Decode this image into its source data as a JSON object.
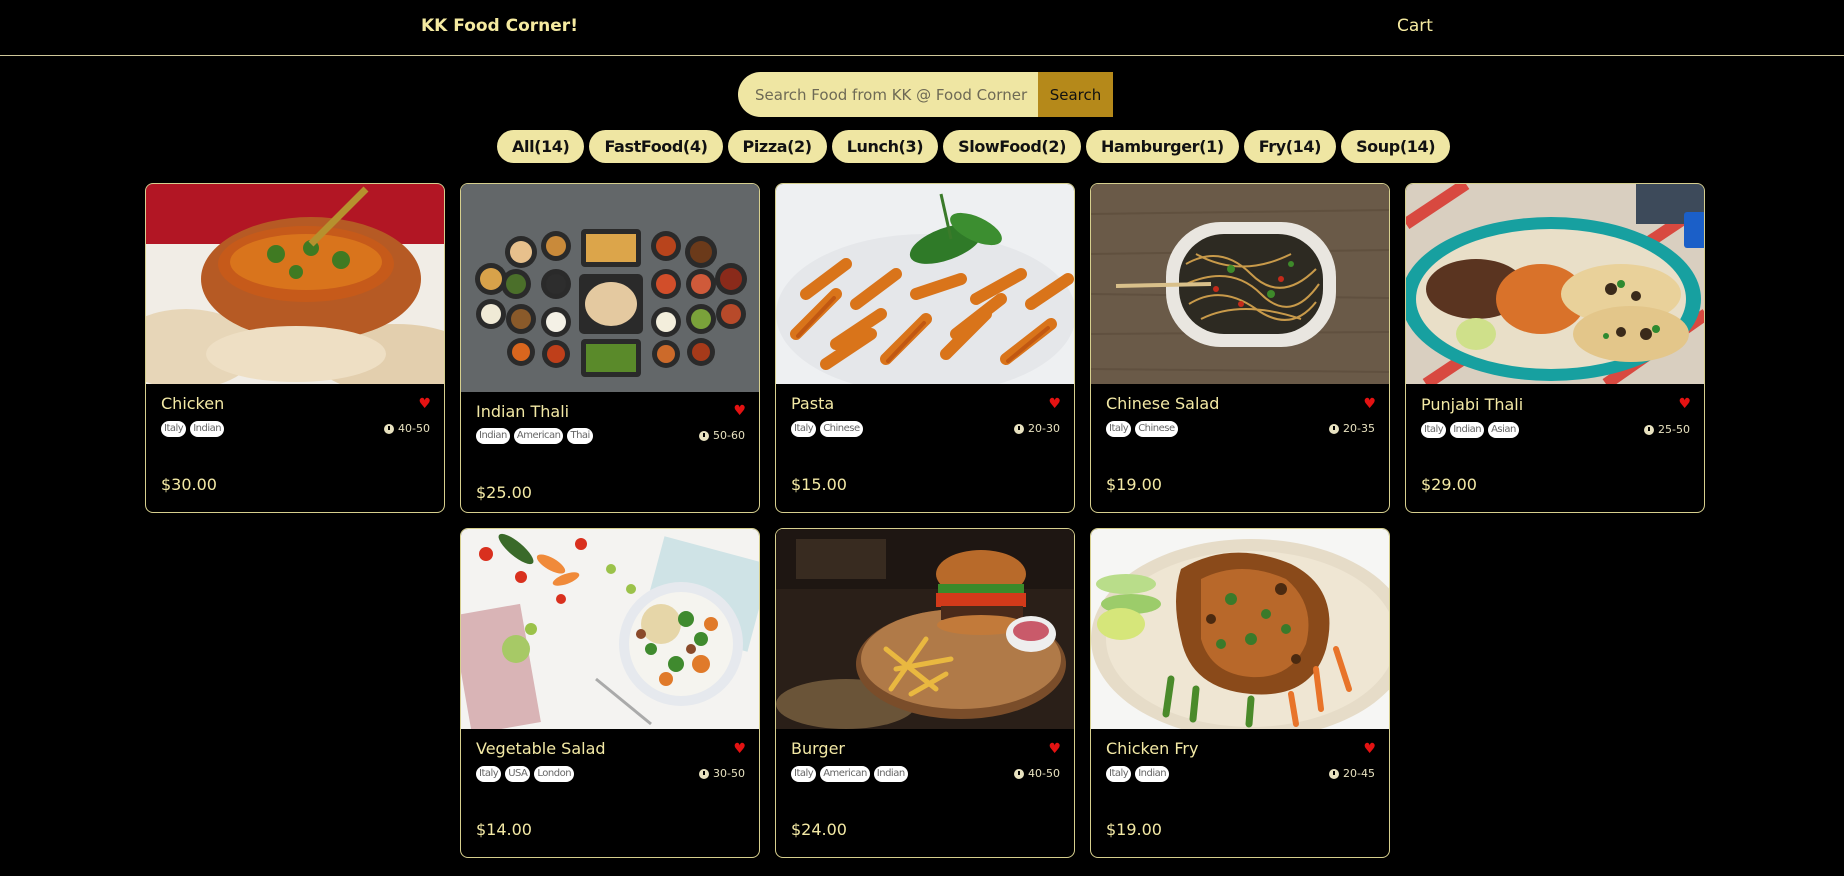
{
  "header": {
    "logo": "KK Food Corner!",
    "cart": "Cart"
  },
  "search": {
    "placeholder": "Search Food from KK @ Food Corner",
    "button": "Search"
  },
  "tags": [
    "All(14)",
    "FastFood(4)",
    "Pizza(2)",
    "Lunch(3)",
    "SlowFood(2)",
    "Hamburger(1)",
    "Fry(14)",
    "Soup(14)"
  ],
  "colors": {
    "accent": "#efe6a3",
    "button": "#b5891a",
    "heart": "#e41212",
    "border": "#d6cf8e"
  },
  "foods": [
    {
      "name": "Chicken",
      "origins": [
        "Italy",
        "Indian"
      ],
      "time": "40-50",
      "price": "$30.00",
      "favorite": true,
      "icon": "heart-icon"
    },
    {
      "name": "Indian Thali",
      "origins": [
        "Indian",
        "American",
        "Thai"
      ],
      "time": "50-60",
      "price": "$25.00",
      "favorite": true,
      "icon": "heart-icon"
    },
    {
      "name": "Pasta",
      "origins": [
        "Italy",
        "Chinese"
      ],
      "time": "20-30",
      "price": "$15.00",
      "favorite": true,
      "icon": "heart-icon"
    },
    {
      "name": "Chinese Salad",
      "origins": [
        "Italy",
        "Chinese"
      ],
      "time": "20-35",
      "price": "$19.00",
      "favorite": true,
      "icon": "heart-icon"
    },
    {
      "name": "Punjabi Thali",
      "origins": [
        "Italy",
        "Indian",
        "Asian"
      ],
      "time": "25-50",
      "price": "$29.00",
      "favorite": true,
      "icon": "heart-icon"
    },
    {
      "name": "Vegetable Salad",
      "origins": [
        "Italy",
        "USA",
        "London"
      ],
      "time": "30-50",
      "price": "$14.00",
      "favorite": true,
      "icon": "heart-icon"
    },
    {
      "name": "Burger",
      "origins": [
        "Italy",
        "American",
        "Indian"
      ],
      "time": "40-50",
      "price": "$24.00",
      "favorite": true,
      "icon": "heart-icon"
    },
    {
      "name": "Chicken Fry",
      "origins": [
        "Italy",
        "Indian"
      ],
      "time": "20-45",
      "price": "$19.00",
      "favorite": true,
      "icon": "heart-icon"
    }
  ]
}
